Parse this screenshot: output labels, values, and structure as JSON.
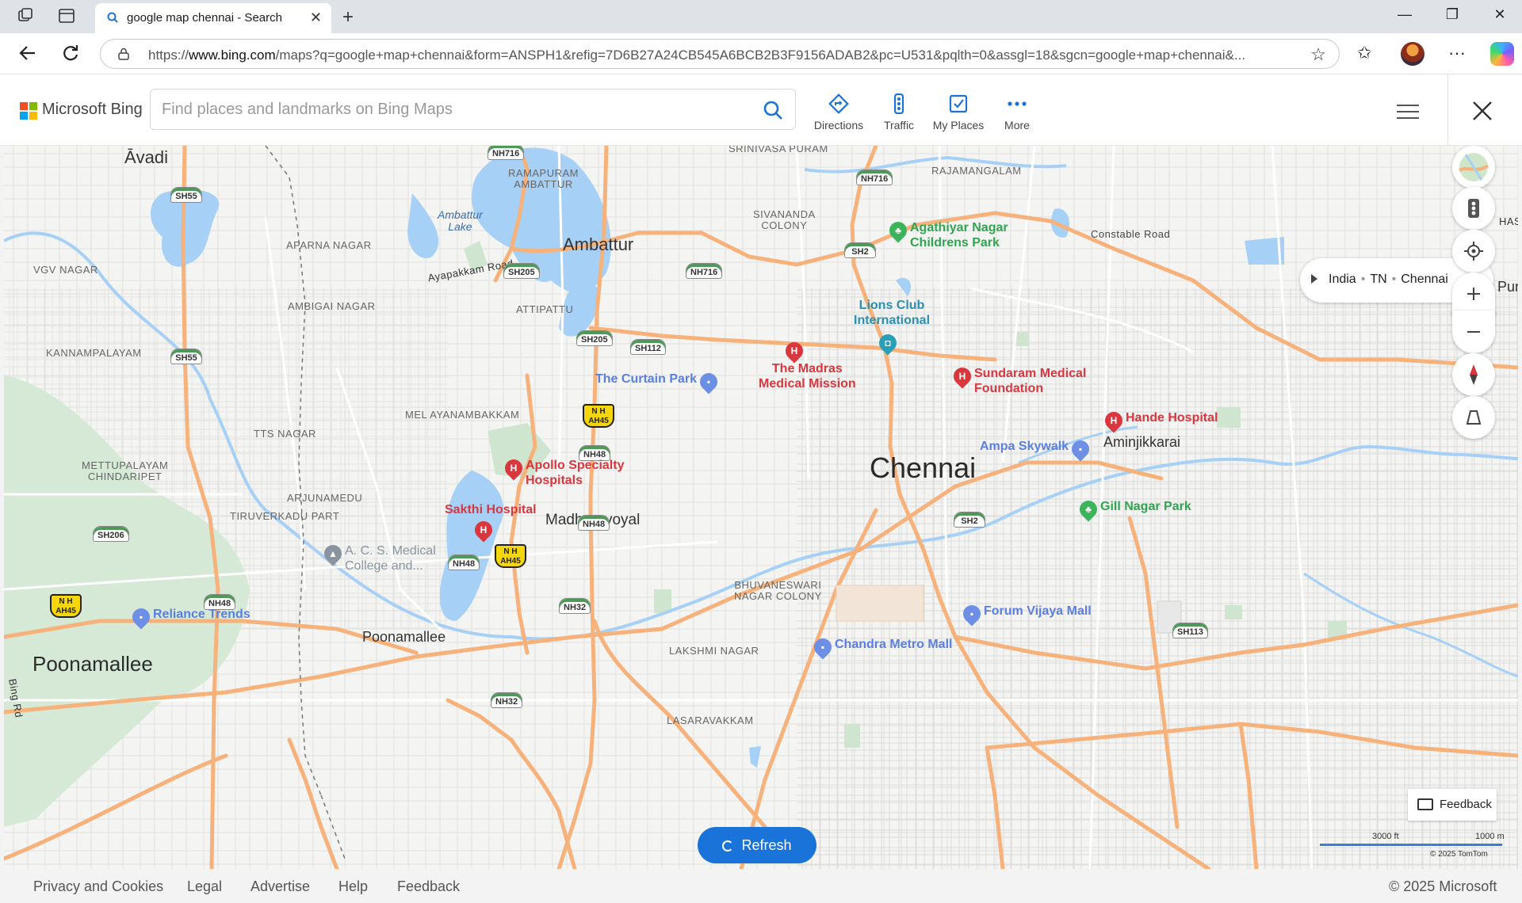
{
  "browser": {
    "tab_title": "google map chennai - Search",
    "url_prefix": "https://",
    "url_host": "www.bing.com",
    "url_path": "/maps?q=google+map+chennai&form=ANSPH1&refig=7D6B27A24CB545A6BCB2B3F9156ADAB2&pc=U531&pqlth=0&assgl=18&sgcn=google+map+chennai&..."
  },
  "bing": {
    "brand": "Microsoft Bing",
    "search_placeholder": "Find places and landmarks on Bing Maps",
    "search_value": "",
    "buttons": {
      "directions": "Directions",
      "traffic": "Traffic",
      "my_places": "My Places",
      "more": "More"
    }
  },
  "map": {
    "breadcrumb": [
      "India",
      "TN",
      "Chennai"
    ],
    "refresh_label": "Refresh",
    "feedback_label": "Feedback",
    "scale_ft": "3000 ft",
    "scale_m": "1000 m",
    "copyright": "© 2025 TomTom",
    "places": {
      "avadi": "Āvadi",
      "ambattur": "Ambattur",
      "chennai": "Chennai",
      "madhuravoyal": "Madhuravoyal",
      "poonamallee_big": "Poonamallee",
      "poonamallee_med": "Poonamallee",
      "aminjikkarai": "Aminjikkarai",
      "srinivasa_puram": "SRINIVASA PURAM",
      "ramapuram_ambattur": "RAMAPURAM\nAMBATTUR",
      "rajamangalam": "RAJAMANGALAM",
      "sivananda_colony": "SIVANANDA\nCOLONY",
      "aparna_nagar": "APARNA NAGAR",
      "vgv_nagar": "VGV NAGAR",
      "ambigai_nagar": "AMBIGAI NAGAR",
      "attipattu": "ATTIPATTU",
      "kannampalayam": "KANNAMPALAYAM",
      "mel_ayanambakkam": "MEL AYANAMBAKKAM",
      "tts_nagar": "TTS NAGAR",
      "mettupalayam": "METTUPALAYAM\nCHINDARIPET",
      "arjunamedu": "ARJUNAMEDU",
      "tiruverkadu_part": "TIRUVERKADU PART",
      "bhuvaneswari": "BHUVANESWARI\nNAGAR COLONY",
      "lakshmi_nagar": "LAKSHMI NAGAR",
      "lasaravakkam": "LASARAVAKKAM",
      "constable_road": "Constable Road",
      "ambattur_lake": "Ambattur\nLake",
      "ayapakkam_road": "Ayapakkam Road",
      "edge_left_road": "Bing Rd",
      "edge_has": "HAS",
      "edge_pura": "Pura"
    },
    "shields": [
      "NH716",
      "SH55",
      "SH205",
      "SH205",
      "NH716",
      "SH112",
      "SH2",
      "NH716",
      "SH55",
      "NH48",
      "NH48",
      "SH206",
      "NH48",
      "NH48",
      "NH32",
      "NH32",
      "SH2",
      "SH113"
    ],
    "ah_shields": [
      "AH45",
      "AH45",
      "AH45"
    ],
    "pois": {
      "agathiyar": "Agathiyar Nagar\nChildrens Park",
      "madras_mission": "The Madras\nMedical Mission",
      "lions_club": "Lions Club\nInternational",
      "sundaram": "Sundaram Medical\nFoundation",
      "curtain_park": "The Curtain Park",
      "hande": "Hande Hospital",
      "ampa": "Ampa Skywalk",
      "apollo": "Apollo Specialty\nHospitals",
      "sakthi": "Sakthi Hospital",
      "gill_nagar": "Gill Nagar Park",
      "acs_medical": "A. C. S. Medical\nCollege and...",
      "reliance": "Reliance Trends",
      "forum_vijaya": "Forum Vijaya Mall",
      "chandra": "Chandra Metro Mall"
    }
  },
  "footer": {
    "links": [
      "Privacy and Cookies",
      "Legal",
      "Advertise",
      "Help",
      "Feedback"
    ],
    "copyright": "© 2025 Microsoft"
  },
  "colors": {
    "accent": "#1a73d9",
    "hospital": "#d9363e",
    "park": "#3bb45c",
    "shop": "#6e8fe6",
    "water": "#a6d0f5",
    "major_road": "#f6b27a"
  },
  "icons": [
    "tab-actions-icon",
    "vertical-tabs-icon",
    "search-icon",
    "back-icon",
    "reload-icon",
    "lock-icon",
    "favorite-star-icon",
    "favorites-icon",
    "more-icon",
    "copilot-icon",
    "directions-icon",
    "traffic-icon",
    "my-places-icon",
    "more-dots-icon",
    "hamburger-icon",
    "close-icon",
    "map-style-icon",
    "traffic-light-icon",
    "locate-icon",
    "zoom-in-icon",
    "zoom-out-icon",
    "compass-icon",
    "tilt-icon"
  ]
}
